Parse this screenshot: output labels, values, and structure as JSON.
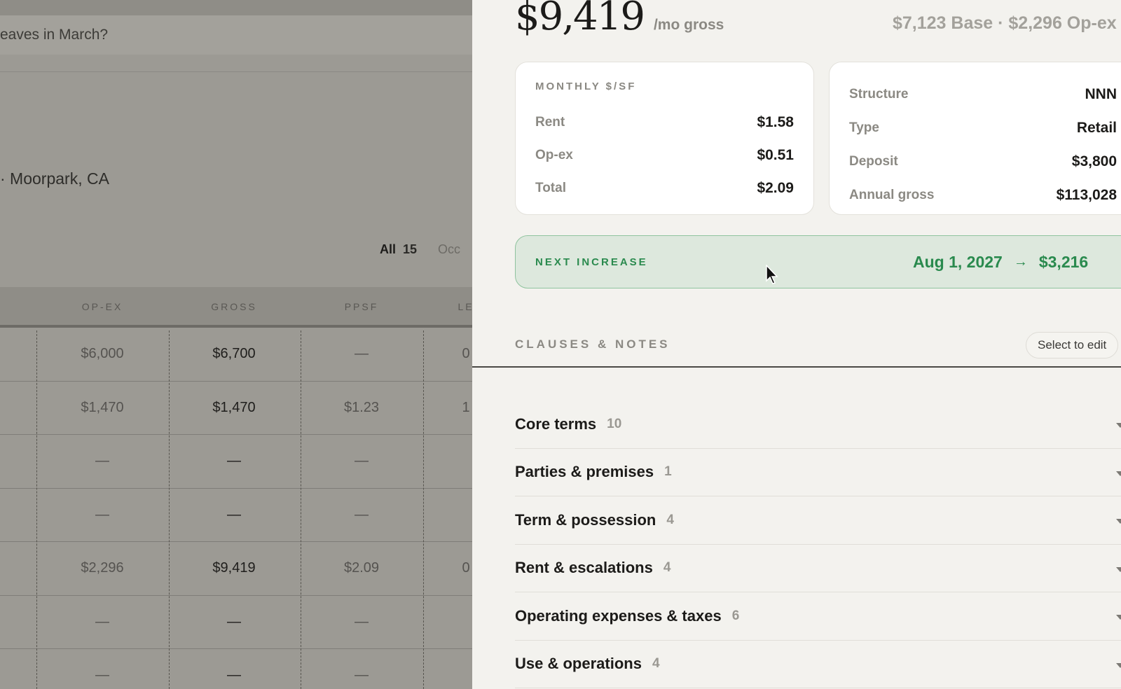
{
  "background": {
    "search_text": "eaves in March?",
    "location": "· Moorpark, CA",
    "filters": {
      "all_label": "All",
      "all_count": "15",
      "other_label": "Occ"
    },
    "columns": [
      "OP-EX",
      "GROSS",
      "PPSF",
      "LE"
    ],
    "rows": [
      {
        "opex": "$6,000",
        "gross": "$6,700",
        "ppsf": "—",
        "le": "0"
      },
      {
        "opex": "$1,470",
        "gross": "$1,470",
        "ppsf": "$1.23",
        "le": "1"
      },
      {
        "opex": "—",
        "gross": "—",
        "ppsf": "—",
        "le": ""
      },
      {
        "opex": "—",
        "gross": "—",
        "ppsf": "—",
        "le": ""
      },
      {
        "opex": "$2,296",
        "gross": "$9,419",
        "ppsf": "$2.09",
        "le": "0"
      },
      {
        "opex": "—",
        "gross": "—",
        "ppsf": "—",
        "le": ""
      },
      {
        "opex": "—",
        "gross": "—",
        "ppsf": "—",
        "le": ""
      }
    ]
  },
  "panel": {
    "hero": {
      "amount": "$9,419",
      "suffix": "/mo gross",
      "breakdown": "$7,123 Base · $2,296 Op-ex"
    },
    "monthly_card": {
      "title": "MONTHLY $/SF",
      "rows": [
        {
          "label": "Rent",
          "value": "$1.58"
        },
        {
          "label": "Op-ex",
          "value": "$0.51"
        },
        {
          "label": "Total",
          "value": "$2.09"
        }
      ]
    },
    "details_card": {
      "rows": [
        {
          "label": "Structure",
          "value": "NNN"
        },
        {
          "label": "Type",
          "value": "Retail"
        },
        {
          "label": "Deposit",
          "value": "$3,800"
        },
        {
          "label": "Annual gross",
          "value": "$113,028"
        }
      ]
    },
    "next_increase": {
      "label": "NEXT INCREASE",
      "date": "Aug 1, 2027",
      "arrow": "→",
      "amount": "$3,216"
    },
    "clauses": {
      "title": "CLAUSES & NOTES",
      "edit_button": "Select to edit",
      "sections": [
        {
          "title": "Core terms",
          "count": "10"
        },
        {
          "title": "Parties & premises",
          "count": "1"
        },
        {
          "title": "Term & possession",
          "count": "4"
        },
        {
          "title": "Rent & escalations",
          "count": "4"
        },
        {
          "title": "Operating expenses & taxes",
          "count": "6"
        },
        {
          "title": "Use & operations",
          "count": "4"
        }
      ]
    }
  },
  "colors": {
    "accent_green": "#2a8a4e",
    "increase_bg": "#dde8dd",
    "panel_bg": "#f3f2ee",
    "overlay_bg": "#9c9a94"
  }
}
